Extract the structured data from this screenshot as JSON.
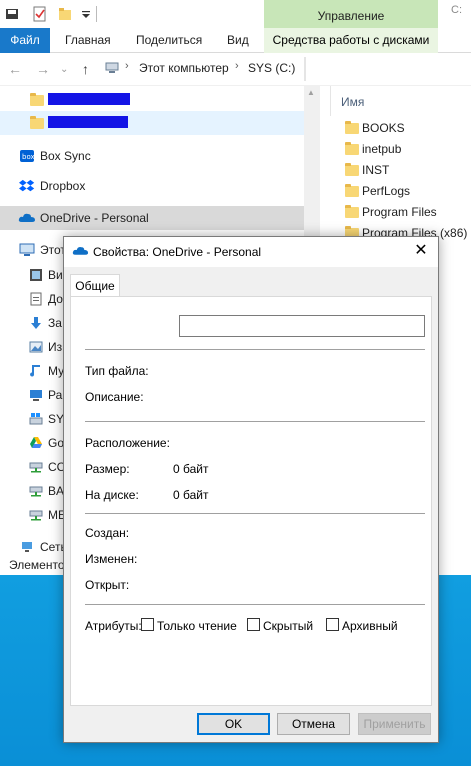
{
  "quick_access": {
    "icons": [
      "save-icon",
      "properties-check-icon",
      "new-folder-icon",
      "customize-arrow-icon"
    ],
    "caption_partial": "C:"
  },
  "ribbon": {
    "file_tab": "Файл",
    "tabs": [
      "Главная",
      "Поделиться",
      "Вид"
    ],
    "context_group": "Управление",
    "context_tab": "Средства работы с дисками"
  },
  "address": {
    "back_icon": "arrow-left-icon",
    "forward_icon": "arrow-right-icon",
    "up_icon": "arrow-up-icon",
    "crumbs": [
      "Этот компьютер",
      "SYS (C:)"
    ]
  },
  "nav": {
    "items": [
      {
        "label": "Box Sync",
        "icon": "box-icon"
      },
      {
        "label": "Dropbox",
        "icon": "dropbox-icon"
      },
      {
        "label": "OneDrive - Personal",
        "icon": "onedrive-cloud-icon"
      },
      {
        "label": "Этот",
        "icon": "this-pc-icon"
      },
      {
        "label": "Ви",
        "icon": "videos-icon"
      },
      {
        "label": "До",
        "icon": "documents-icon"
      },
      {
        "label": "За",
        "icon": "downloads-icon"
      },
      {
        "label": "Из",
        "icon": "pictures-icon"
      },
      {
        "label": "Му",
        "icon": "music-icon"
      },
      {
        "label": "Ра",
        "icon": "desktop-icon"
      },
      {
        "label": "SYS",
        "icon": "drive-icon"
      },
      {
        "label": "Go",
        "icon": "google-drive-icon"
      },
      {
        "label": "CC",
        "icon": "network-drive-icon"
      },
      {
        "label": "BA",
        "icon": "network-drive-icon"
      },
      {
        "label": "ME",
        "icon": "network-drive-icon"
      },
      {
        "label": "Сеть",
        "icon": "network-icon"
      }
    ]
  },
  "content": {
    "column_header": "Имя",
    "files": [
      "BOOKS",
      "inetpub",
      "INST",
      "PerfLogs",
      "Program Files",
      "Program Files (x86)"
    ]
  },
  "status": {
    "text": "Элементо"
  },
  "dialog": {
    "title": "Свойства: OneDrive - Personal",
    "close_label": "✕",
    "tab": "Общие",
    "name_value": "",
    "labels": {
      "file_type": "Тип файла:",
      "description": "Описание:",
      "location": "Расположение:",
      "size": "Размер:",
      "size_on_disk": "На диске:",
      "created": "Создан:",
      "modified": "Изменен:",
      "accessed": "Открыт:",
      "attributes": "Атрибуты:"
    },
    "values": {
      "file_type": "",
      "description": "",
      "location": "",
      "size": "0 байт",
      "size_on_disk": "0 байт",
      "created": "",
      "modified": "",
      "accessed": ""
    },
    "attributes": {
      "readonly": {
        "label": "Только чтение",
        "checked": false
      },
      "hidden": {
        "label": "Скрытый",
        "checked": false
      },
      "archive": {
        "label": "Архивный",
        "checked": false
      }
    },
    "buttons": {
      "ok": "OK",
      "cancel": "Отмена",
      "apply": "Применить"
    }
  },
  "colors": {
    "accent": "#1979ca",
    "context_band": "#c8e6b8",
    "desktop": "#0a8fd6",
    "redaction": "#1414e6",
    "folder": "#f8d775"
  }
}
